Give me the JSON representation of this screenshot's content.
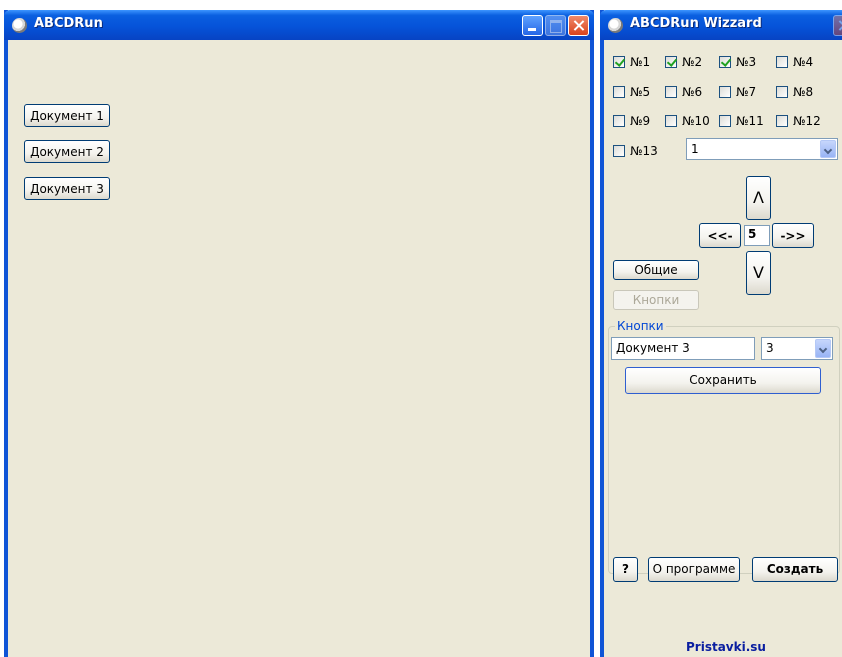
{
  "main_window": {
    "title": "ABCDRun",
    "documents": [
      "Документ 1",
      "Документ 2",
      "Документ 3"
    ]
  },
  "wizard_window": {
    "title": "ABCDRun Wizzard",
    "checkboxes": [
      {
        "label": "№1",
        "checked": true
      },
      {
        "label": "№2",
        "checked": true
      },
      {
        "label": "№3",
        "checked": true
      },
      {
        "label": "№4",
        "checked": false
      },
      {
        "label": "№5",
        "checked": false
      },
      {
        "label": "№6",
        "checked": false
      },
      {
        "label": "№7",
        "checked": false
      },
      {
        "label": "№8",
        "checked": false
      },
      {
        "label": "№9",
        "checked": false
      },
      {
        "label": "№10",
        "checked": false
      },
      {
        "label": "№11",
        "checked": false
      },
      {
        "label": "№12",
        "checked": false
      },
      {
        "label": "№13",
        "checked": false
      }
    ],
    "select_value": "1",
    "nav": {
      "up": "Λ",
      "left": "<<-",
      "value": "5",
      "right": "->>",
      "down": "V"
    },
    "general_button": "Общие",
    "buttons_button": "Кнопки",
    "group": {
      "title": "Кнопки",
      "name_value": "Документ 3",
      "count_value": "3",
      "save_button": "Сохранить"
    },
    "help_button": "?",
    "about_button": "О программе",
    "create_button": "Создать",
    "footer_link": "Pristavki.su"
  },
  "colors": {
    "title_bar": "#0653d9",
    "window_bg": "#ece9d8",
    "group_title": "#0046d5",
    "link": "#0a1ea0"
  }
}
